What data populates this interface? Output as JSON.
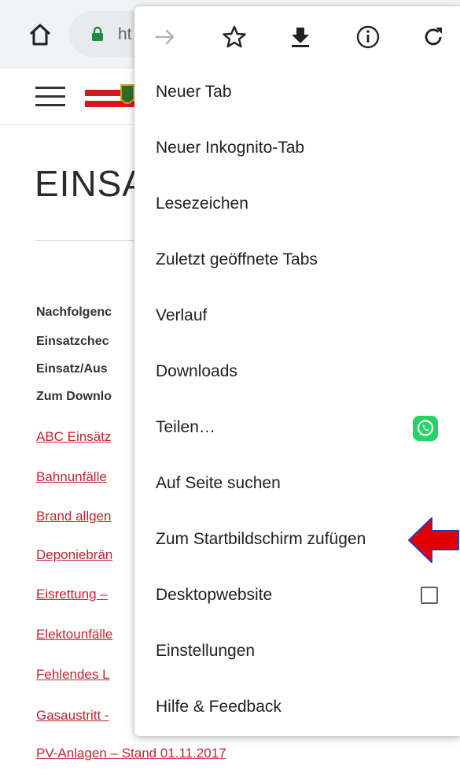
{
  "browser": {
    "url_partial": "ht",
    "icons": [
      "home-icon",
      "lock-icon",
      "forward-icon",
      "bookmark-star-icon",
      "download-icon",
      "info-icon",
      "reload-icon"
    ]
  },
  "page": {
    "title": "EINSA",
    "intro_lines": [
      "Nachfolgenc",
      "Einsatzchec",
      "Einsatz/Aus",
      "Zum Downlo"
    ],
    "links": [
      "ABC Einsätz",
      "Bahnunfälle",
      "Brand allgen",
      "Deponiebrän",
      "Eisrettung –",
      "Elektounfälle",
      "Fehlendes L",
      "Gasaustritt -",
      "PV-Anlagen – Stand 01.11.2017"
    ]
  },
  "menu": {
    "items": [
      {
        "label": "Neuer Tab"
      },
      {
        "label": "Neuer Inkognito-Tab"
      },
      {
        "label": "Lesezeichen"
      },
      {
        "label": "Zuletzt geöffnete Tabs"
      },
      {
        "label": "Verlauf"
      },
      {
        "label": "Downloads"
      },
      {
        "label": "Teilen…",
        "icon": "whatsapp-icon"
      },
      {
        "label": "Auf Seite suchen"
      },
      {
        "label": "Zum Startbildschirm zufügen"
      },
      {
        "label": "Desktopwebsite",
        "checkbox_checked": false
      },
      {
        "label": "Einstellungen"
      },
      {
        "label": "Hilfe & Feedback"
      }
    ]
  },
  "colors": {
    "link": "#c0262e",
    "whatsapp": "#25d366",
    "annotation_arrow": "#e00000",
    "annotation_arrow_outline": "#1f3fbf"
  }
}
